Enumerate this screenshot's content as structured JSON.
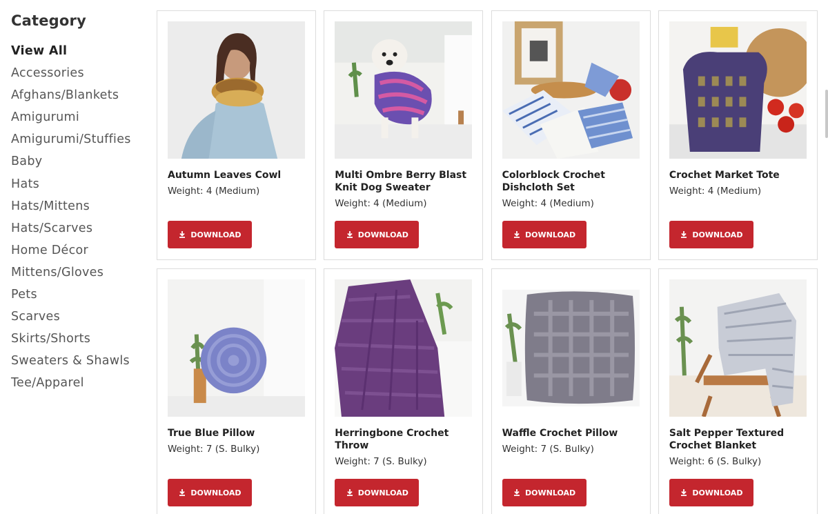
{
  "sidebar": {
    "title": "Category",
    "items": [
      {
        "label": "View All"
      },
      {
        "label": "Accessories"
      },
      {
        "label": "Afghans/Blankets"
      },
      {
        "label": "Amigurumi"
      },
      {
        "label": "Amigurumi/Stuffies"
      },
      {
        "label": "Baby"
      },
      {
        "label": "Hats"
      },
      {
        "label": "Hats/Mittens"
      },
      {
        "label": "Hats/Scarves"
      },
      {
        "label": "Home Décor"
      },
      {
        "label": "Mittens/Gloves"
      },
      {
        "label": "Pets"
      },
      {
        "label": "Scarves"
      },
      {
        "label": "Skirts/Shorts"
      },
      {
        "label": "Sweaters & Shawls"
      },
      {
        "label": "Tee/Apparel"
      }
    ]
  },
  "products": [
    {
      "name": "Autumn Leaves Cowl",
      "weight": "Weight: 4 (Medium)",
      "download_label": "DOWNLOAD",
      "image": "woman-cowl"
    },
    {
      "name": "Multi Ombre Berry Blast Knit Dog Sweater",
      "weight": "Weight: 4 (Medium)",
      "download_label": "DOWNLOAD",
      "image": "dog-sweater"
    },
    {
      "name": "Colorblock Crochet Dishcloth Set",
      "weight": "Weight: 4 (Medium)",
      "download_label": "DOWNLOAD",
      "image": "dishcloths"
    },
    {
      "name": "Crochet Market Tote",
      "weight": "Weight: 4 (Medium)",
      "download_label": "DOWNLOAD",
      "image": "market-tote"
    },
    {
      "name": "True Blue Pillow",
      "weight": "Weight: 7 (S. Bulky)",
      "download_label": "DOWNLOAD",
      "image": "round-pillow"
    },
    {
      "name": "Herringbone Crochet Throw",
      "weight": "Weight: 7 (S. Bulky)",
      "download_label": "DOWNLOAD",
      "image": "purple-throw"
    },
    {
      "name": "Waffle Crochet Pillow",
      "weight": "Weight: 7 (S. Bulky)",
      "download_label": "DOWNLOAD",
      "image": "waffle-pillow"
    },
    {
      "name": "Salt Pepper Textured Crochet Blanket",
      "weight": "Weight: 6 (S. Bulky)",
      "download_label": "DOWNLOAD",
      "image": "chair-blanket"
    }
  ],
  "colors": {
    "accent": "#c4262e",
    "text": "#333333",
    "border": "#dcdcdc"
  }
}
